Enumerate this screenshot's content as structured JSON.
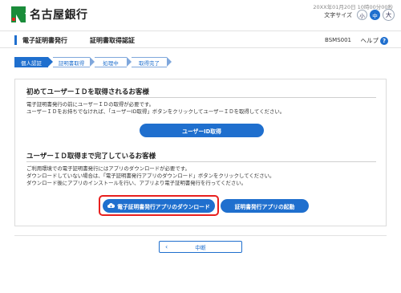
{
  "header": {
    "bank_name": "名古屋銀行",
    "datetime": "20XX年01月20日 10時00分00秒",
    "font_size_label": "文字サイズ",
    "font_sizes": [
      "小",
      "中",
      "大"
    ],
    "active_font_size": "中"
  },
  "titlebar": {
    "title": "電子証明書発行",
    "subtitle": "証明書取得認証",
    "screen_id": "BSMS001",
    "help_label": "ヘルプ",
    "help_icon": "?"
  },
  "steps": [
    "個人認証",
    "証明書取得",
    "処理中",
    "取得完了"
  ],
  "section1": {
    "title": "初めてユーザーＩＤを取得されるお客様",
    "line1": "電子証明書発行の前にユーザーＩＤの取得が必要です。",
    "line2": "ユーザーＩＤをお持ちでなければ、「ユーザーID取得」ボタンをクリックしてユーザーＩＤを取得してください。",
    "button": "ユーザーID取得"
  },
  "section2": {
    "title": "ユーザーＩＤ取得まで完了しているお客様",
    "line1": "ご利用環境での電子証明書発行にはアプリのダウンロードが必要です。",
    "line2": "ダウンロードしていない場合は、「電子証明書発行アプリのダウンロード」ボタンをクリックしてください。",
    "line3": "ダウンロード後にアプリのインストールを行い、アプリより電子証明書発行を行ってください。",
    "download_button": "電子証明書発行アプリのダウンロード",
    "launch_button": "証明書発行アプリの起動"
  },
  "footer": {
    "cancel_button": "中断"
  },
  "colors": {
    "accent": "#1f6fce",
    "highlight": "#e8201f",
    "logo_green": "#1a8c3a"
  },
  "icons": {
    "logo": "nagoya-bank-logo-icon",
    "help": "question-circle-icon",
    "download": "cloud-download-icon",
    "back": "chevron-left-icon"
  }
}
